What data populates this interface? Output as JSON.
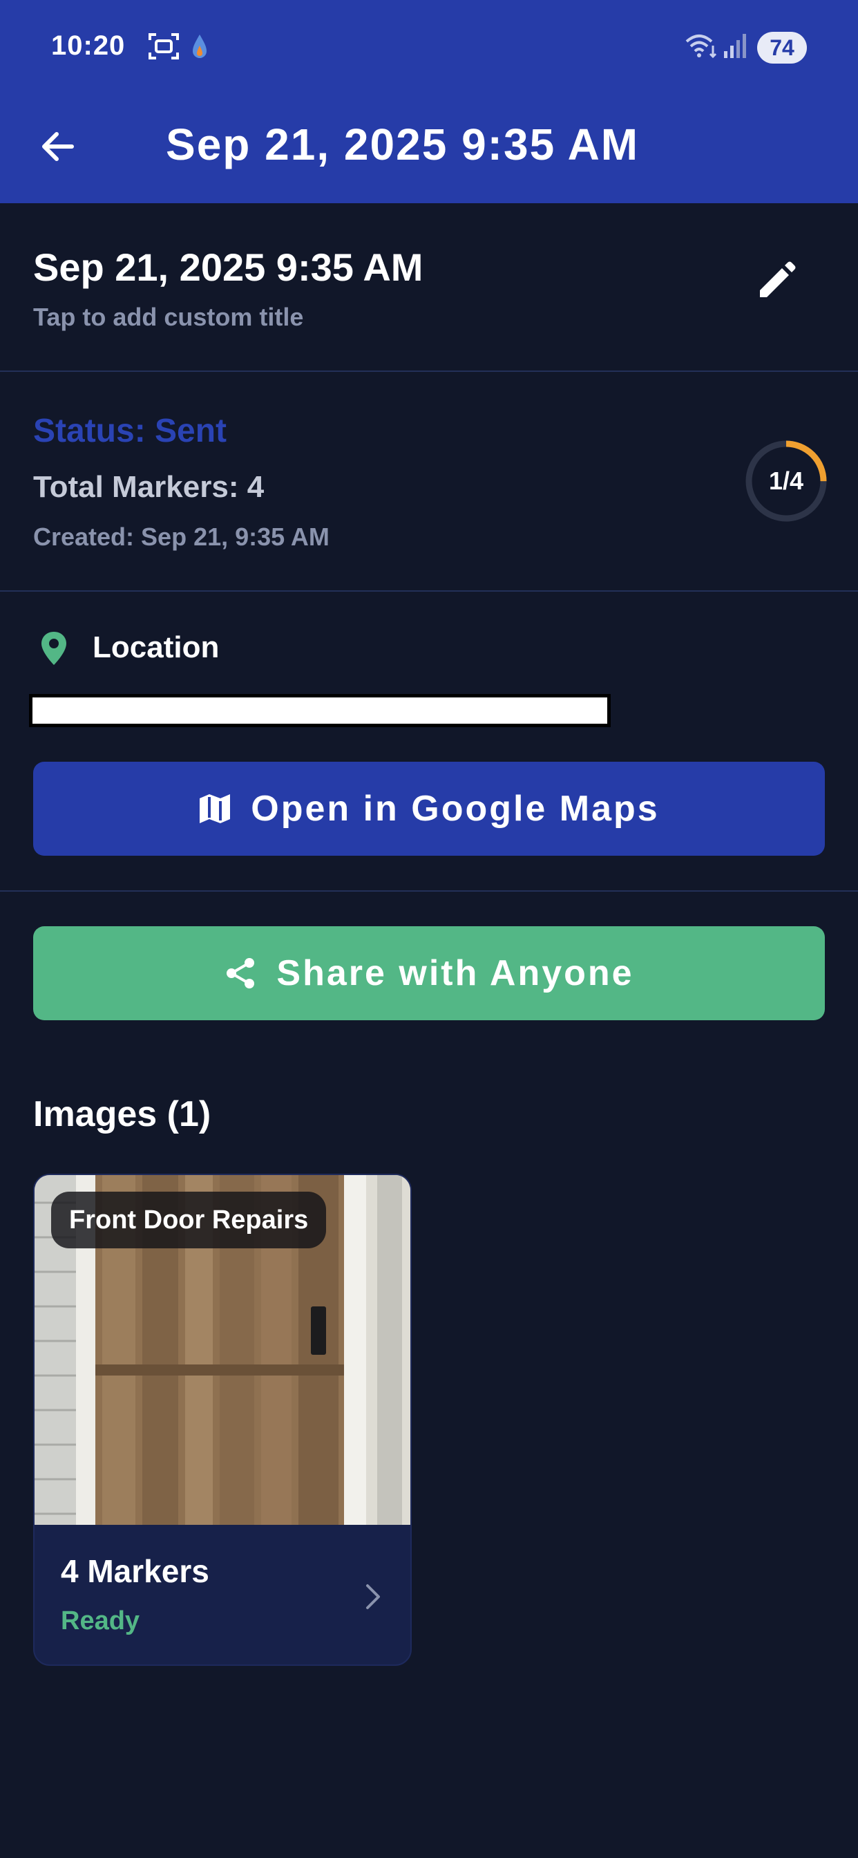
{
  "status_bar": {
    "time": "10:20",
    "battery": "74"
  },
  "app_bar": {
    "title": "Sep 21, 2025 9:35 AM"
  },
  "header": {
    "title": "Sep 21, 2025 9:35 AM",
    "hint": "Tap to add custom title"
  },
  "summary": {
    "status": "Status: Sent",
    "total_markers": "Total Markers: 4",
    "created": "Created: Sep 21, 9:35 AM",
    "progress_label": "1/4",
    "progress_fraction": 0.25
  },
  "location": {
    "label": "Location",
    "maps_button": "Open in Google Maps"
  },
  "share_button": "Share with Anyone",
  "images": {
    "heading": "Images (1)",
    "items": [
      {
        "tag": "Front Door Repairs",
        "markers": "4 Markers",
        "status": "Ready"
      }
    ]
  },
  "colors": {
    "primary": "#263ca8",
    "background": "#111729",
    "success": "#53b786",
    "accent_progress": "#f0a030"
  },
  "icons": {
    "back": "arrow-left-icon",
    "edit": "pencil-icon",
    "location": "map-pin-icon",
    "maps": "map-icon",
    "share": "share-icon",
    "chevron": "chevron-right-icon"
  }
}
